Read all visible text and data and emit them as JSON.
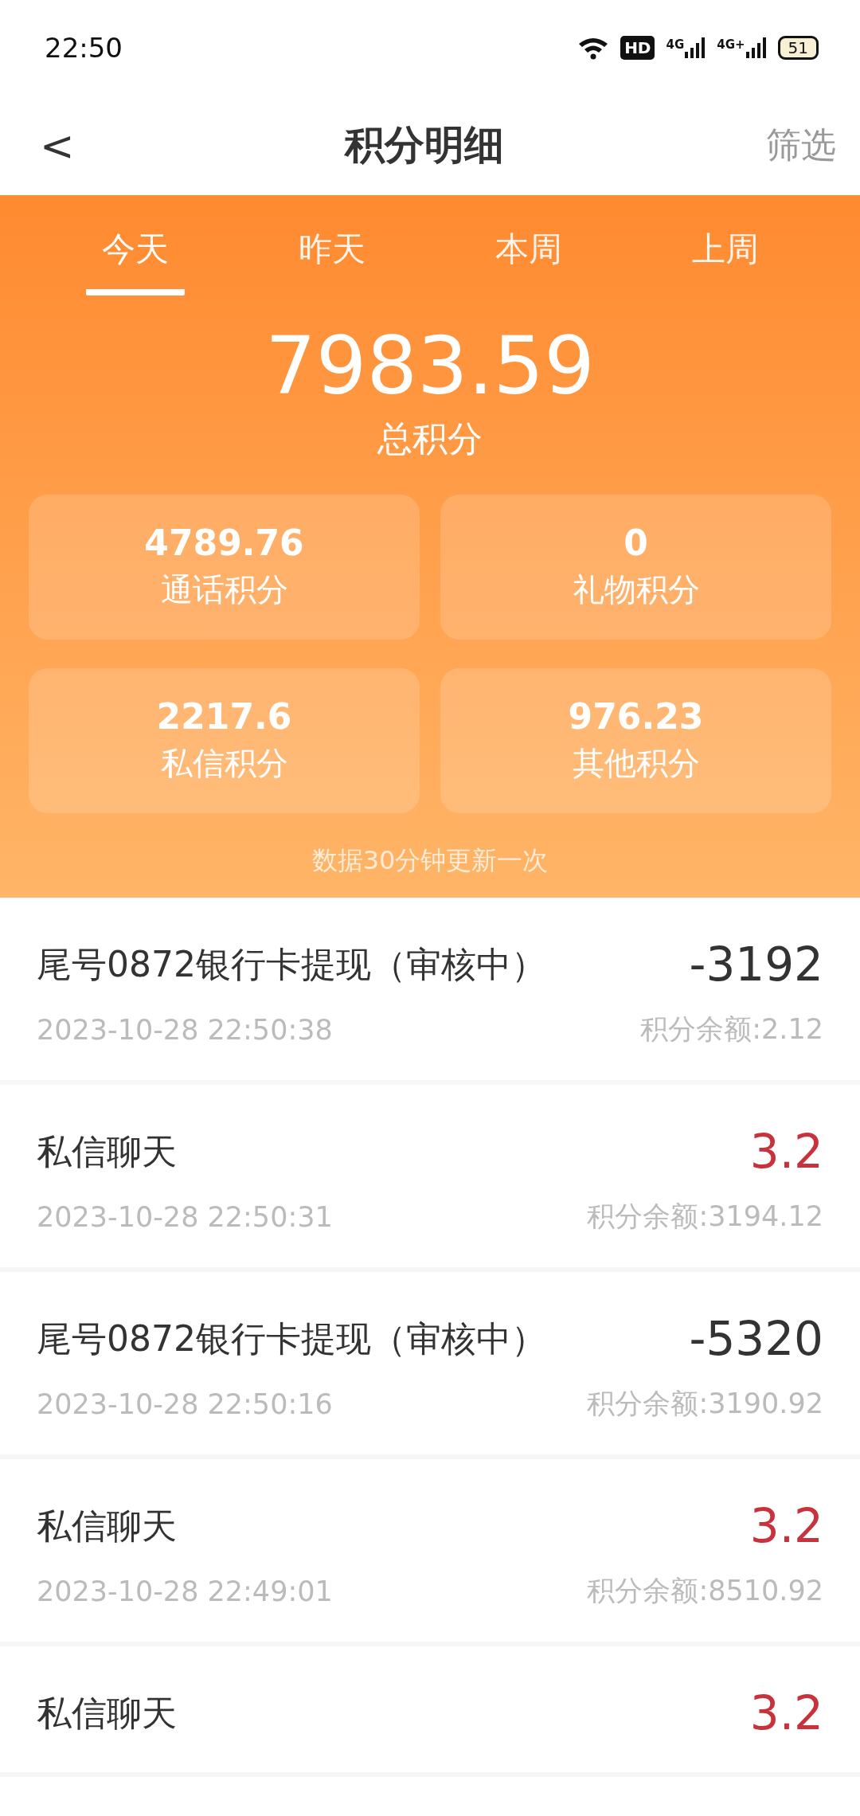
{
  "status_bar": {
    "time": "22:50",
    "hd": "HD",
    "networks": [
      "4G",
      "4G+"
    ],
    "battery": "51"
  },
  "header": {
    "back": "<",
    "title": "积分明细",
    "action": "筛选"
  },
  "tabs": [
    {
      "label": "今天",
      "selected": true
    },
    {
      "label": "昨天",
      "selected": false
    },
    {
      "label": "本周",
      "selected": false
    },
    {
      "label": "上周",
      "selected": false
    }
  ],
  "total": {
    "value": "7983.59",
    "label": "总积分"
  },
  "stats": [
    {
      "value": "4789.76",
      "label": "通话积分"
    },
    {
      "value": "0",
      "label": "礼物积分"
    },
    {
      "value": "2217.6",
      "label": "私信积分"
    },
    {
      "value": "976.23",
      "label": "其他积分"
    }
  ],
  "note": "数据30分钟更新一次",
  "records": [
    {
      "kind": "expense",
      "title": "尾号0872银行卡提现（审核中）",
      "amount": "-3192",
      "time": "2023-10-28 22:50:38",
      "balance": "积分余额:2.12"
    },
    {
      "kind": "income",
      "title": "私信聊天",
      "amount": "3.2",
      "time": "2023-10-28 22:50:31",
      "balance": "积分余额:3194.12"
    },
    {
      "kind": "expense",
      "title": "尾号0872银行卡提现（审核中）",
      "amount": "-5320",
      "time": "2023-10-28 22:50:16",
      "balance": "积分余额:3190.92"
    },
    {
      "kind": "income",
      "title": "私信聊天",
      "amount": "3.2",
      "time": "2023-10-28 22:49:01",
      "balance": "积分余额:8510.92"
    },
    {
      "kind": "income",
      "title": "私信聊天",
      "amount": "3.2"
    }
  ]
}
